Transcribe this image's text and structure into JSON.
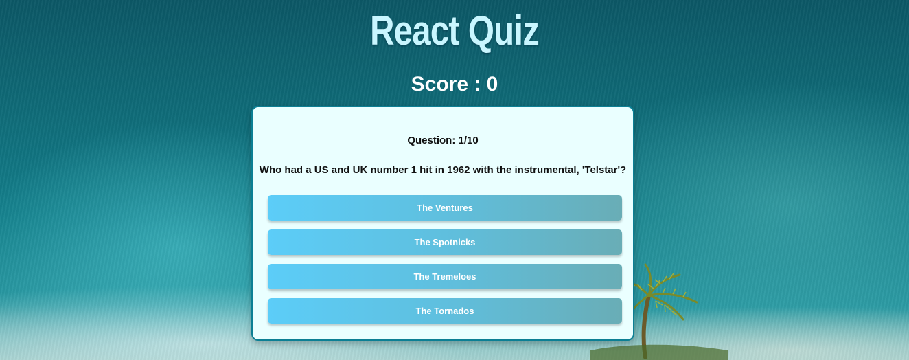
{
  "header": {
    "title": "React Quiz",
    "score_label": "Score : 0"
  },
  "quiz": {
    "question_number": "Question: 1/10",
    "question_text": "Who had a US and UK number 1 hit in 1962 with the instrumental, 'Telstar'?",
    "answers": [
      {
        "label": "The Ventures"
      },
      {
        "label": "The Spotnicks"
      },
      {
        "label": "The Tremeloes"
      },
      {
        "label": "The Tornados"
      }
    ]
  },
  "colors": {
    "title": "#c9f6ff",
    "card_background": "#eaffff",
    "card_border": "#0b7f94",
    "button_gradient_start": "#5ccdf8",
    "button_gradient_end": "#69adb6"
  }
}
